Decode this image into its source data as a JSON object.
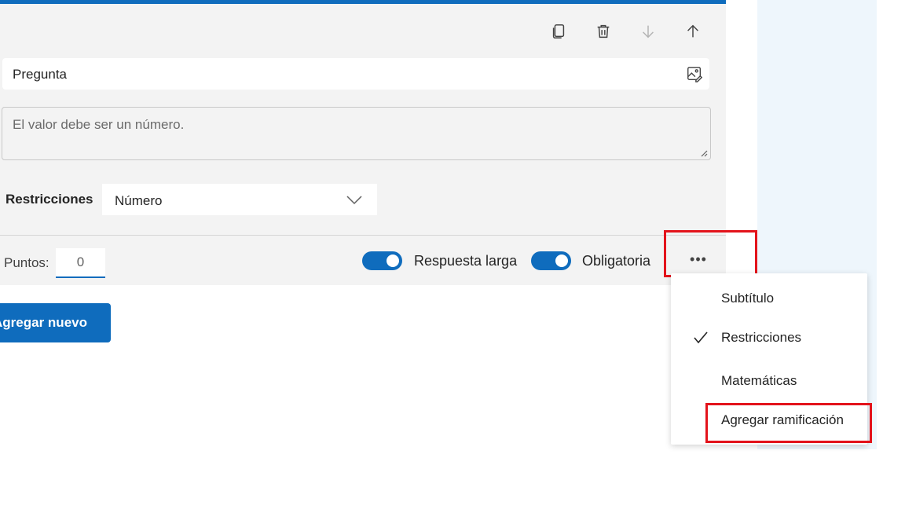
{
  "question": {
    "title_value": "Pregunta",
    "subtitle_placeholder": "El valor debe ser un número."
  },
  "toolbar": {
    "icons": [
      "copy-icon",
      "delete-icon",
      "move-down-icon",
      "move-up-icon"
    ]
  },
  "restrictions": {
    "label": "Restricciones",
    "selected": "Número"
  },
  "footer": {
    "points_label": "Puntos:",
    "points_value": "0",
    "long_answer_label": "Respuesta larga",
    "long_answer_on": true,
    "required_label": "Obligatoria",
    "required_on": true,
    "more_label": "•••"
  },
  "add_new_label": "Agregar nuevo",
  "menu": {
    "items": [
      {
        "label": "Subtítulo",
        "checked": false
      },
      {
        "label": "Restricciones",
        "checked": true
      },
      {
        "label": "Matemáticas",
        "checked": false
      },
      {
        "label": "Agregar ramificación",
        "checked": false
      }
    ]
  },
  "colors": {
    "accent": "#0f6cbd",
    "highlight": "#e3131b",
    "card_bg": "#f3f3f3",
    "side_panel": "#eef6fc"
  }
}
